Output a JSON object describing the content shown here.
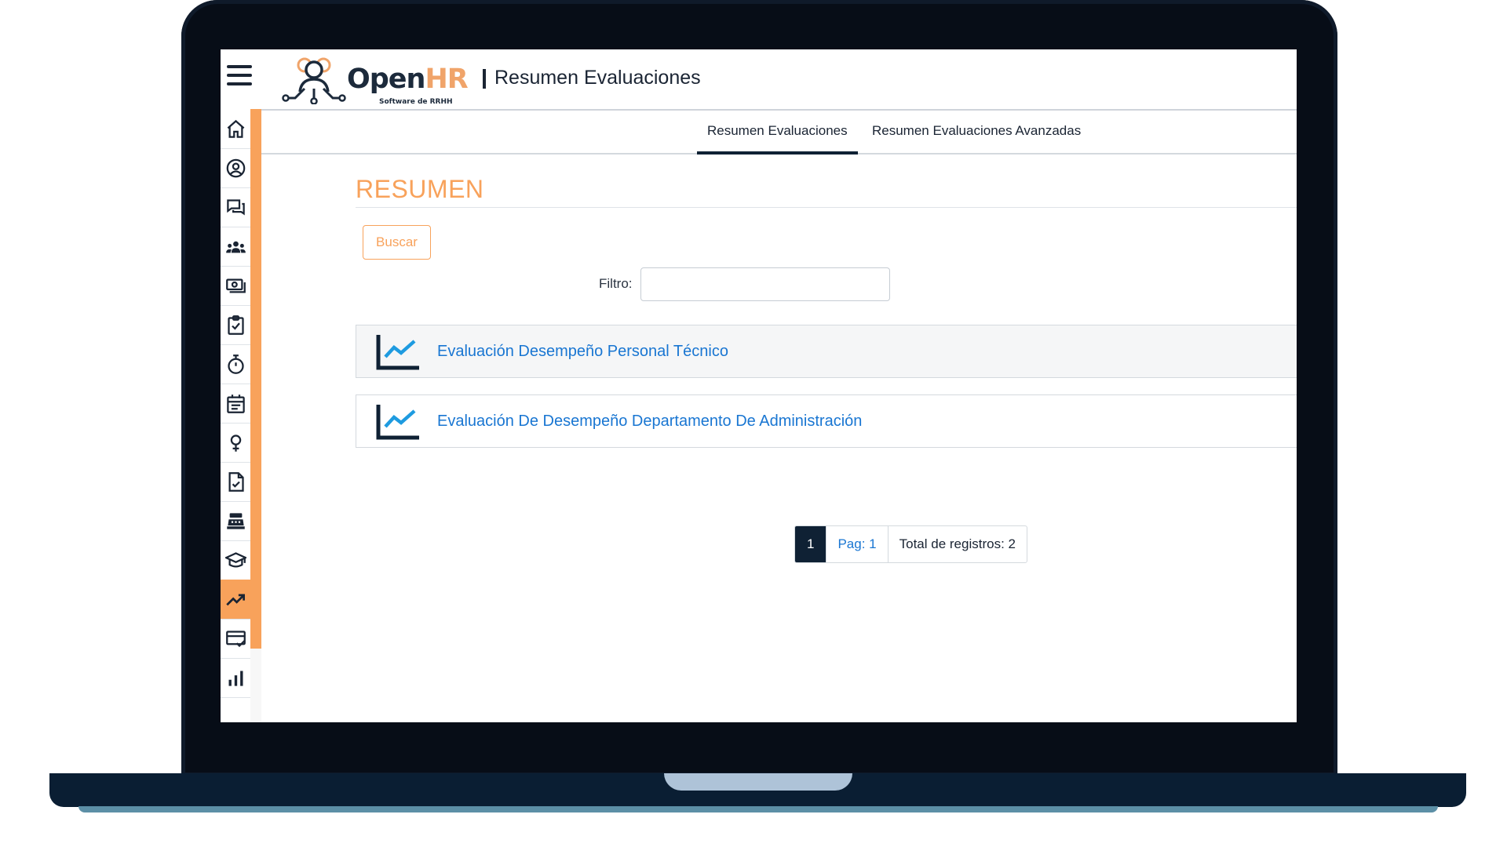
{
  "header": {
    "logo_open": "Open",
    "logo_hr": "HR",
    "logo_tagline": "Software de RRHH",
    "page_title": "Resumen Evaluaciones"
  },
  "sidebar": {
    "items": [
      {
        "icon": "home-icon"
      },
      {
        "icon": "user-circle-icon"
      },
      {
        "icon": "chat-icon"
      },
      {
        "icon": "group-icon"
      },
      {
        "icon": "money-icon"
      },
      {
        "icon": "clipboard-check-icon"
      },
      {
        "icon": "stopwatch-icon"
      },
      {
        "icon": "calendar-icon"
      },
      {
        "icon": "female-icon"
      },
      {
        "icon": "document-check-icon"
      },
      {
        "icon": "cash-register-icon"
      },
      {
        "icon": "graduation-cap-icon"
      },
      {
        "icon": "trending-up-icon",
        "active": true
      },
      {
        "icon": "card-check-icon"
      },
      {
        "icon": "bar-chart-icon"
      }
    ],
    "accent_color": "#f8a25b"
  },
  "tabs": [
    {
      "label": "Resumen Evaluaciones",
      "active": true
    },
    {
      "label": "Resumen Evaluaciones Avanzadas",
      "active": false
    }
  ],
  "main": {
    "section_title": "RESUMEN",
    "search_button": "Buscar",
    "filter_label": "Filtro:",
    "filter_value": "",
    "evaluations": [
      {
        "label": "Evaluación Desempeño Personal Técnico"
      },
      {
        "label": "Evaluación De Desempeño Departamento De Administración"
      }
    ],
    "pagination": {
      "current_page": "1",
      "page_info": "Pag: 1",
      "total": "Total de registros: 2"
    }
  },
  "colors": {
    "accent": "#f8a25b",
    "link": "#1976d2",
    "dark": "#0f2134"
  }
}
